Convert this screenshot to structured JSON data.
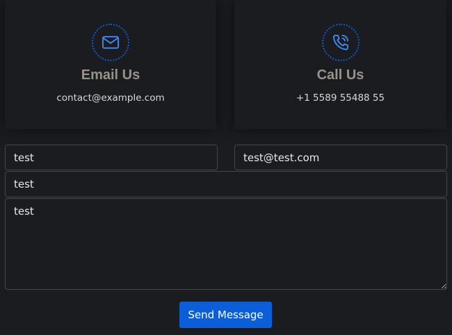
{
  "cards": {
    "email": {
      "icon": "mail-icon",
      "title": "Email Us",
      "value": "contact@example.com"
    },
    "call": {
      "icon": "phone-icon",
      "title": "Call Us",
      "value": "+1 5589 55488 55"
    }
  },
  "form": {
    "name_value": "test",
    "email_value": "test@test.com",
    "subject_value": "test",
    "message_value": "test",
    "submit_label": "Send Message"
  },
  "colors": {
    "background": "#1b1c1f",
    "accent": "#0b5ed7",
    "card_title": "#9a9288",
    "field_border": "#44464b"
  }
}
